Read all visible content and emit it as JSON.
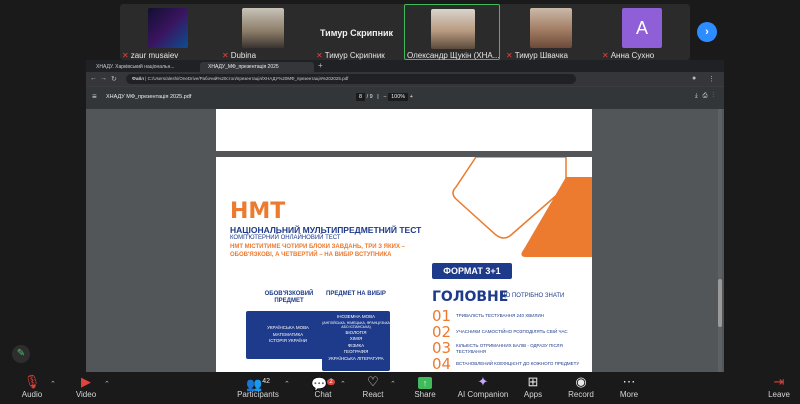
{
  "participants": [
    {
      "name": "zaur musaiev",
      "muted": true
    },
    {
      "name": "Dubina",
      "muted": true
    },
    {
      "name": "Тимур Скрипник",
      "muted": true
    },
    {
      "name": "Олександр Щукін (ХНА...",
      "muted": true
    },
    {
      "name": "Тимур Швачка",
      "muted": true
    },
    {
      "name": "Анна Сухно",
      "muted": true
    }
  ],
  "active_speaker": "Тимур Скрипник",
  "avatar_letter": "A",
  "browser": {
    "tab_active": "ХНАДУ_МФ_презентація 2025",
    "tab_other": "ХНАДУ. Харківський національн...",
    "address": "C:/Users/aleshi/OneDrive/Рабочий%20стол/презентація/ХНАДУ%20МФ_презентація%202025.pdf",
    "address_prefix": "Файл",
    "pdf_title": "ХНАДУ МФ_презентація 2025.pdf",
    "page_current": "8",
    "page_total": "9",
    "zoom": "100%"
  },
  "slide": {
    "title": "НМТ",
    "subtitle": "НАЦІОНАЛЬНИЙ МУЛЬТИПРЕДМЕТНИЙ ТЕСТ",
    "subtitle2": "КОМП'ЮТЕРНИЙ ОНЛАЙНОВИЙ ТЕСТ",
    "description": "НМТ МІСТИТИМЕ ЧОТИРИ БЛОКИ ЗАВДАНЬ, ТРИ З ЯКИХ – ОБОВ'ЯЗКОВІ, А ЧЕТВЕРТИЙ – НА ВИБІР ВСТУПНИКА",
    "format_badge": "ФОРМАТ 3+1",
    "headline": "ГОЛОВНЕ",
    "headline_tail": "ЩО ПОТРІБНО ЗНАТИ",
    "facts": [
      {
        "num": "01",
        "text": "ТРИВАЛІСТЬ ТЕСТУВАННЯ 240 ХВИЛИН"
      },
      {
        "num": "02",
        "text": "УЧАСНИКИ САМОСТІЙНО РОЗПОДІЛЯТЬ СВІЙ ЧАС"
      },
      {
        "num": "03",
        "text": "КІЛЬКІСТЬ ОТРИМАННИХ БАЛІВ - ОДРАЗУ ПІСЛЯ ТЕСТУВАННЯ"
      },
      {
        "num": "04",
        "text": "ВСТАНОВЛЕНИЙ КОЕФІЦІЄНТ ДО КОЖНОГО ПРЕДМЕТУ"
      }
    ],
    "mandatory_head": "ОБОВ'ЯЗКОВИЙ ПРЕДМЕТ",
    "mandatory": [
      "УКРАЇНСЬКА МОВА",
      "МАТЕМАТИКА",
      "ІСТОРІЯ УКРАЇНИ"
    ],
    "elective_head": "ПРЕДМЕТ НА ВИБІР",
    "elective": [
      "ІНОЗЕМНА МОВА",
      "(АНГЛІЙСЬКА, НІМЕЦЬКА, ФРАНЦУЗЬКА АБО ІСПАНСЬКА)",
      "БІОЛОГІЯ",
      "ХІМІЯ",
      "ФІЗИКА",
      "ГЕОГРАФІЯ",
      "УКРАЇНСЬКА ЛІТЕРАТУРА"
    ]
  },
  "toolbar": {
    "audio": "Audio",
    "video": "Video",
    "participants": "Participants",
    "participants_count": "42",
    "chat": "Chat",
    "chat_badge": "2",
    "react": "React",
    "share": "Share",
    "ai": "AI Companion",
    "apps": "Apps",
    "record": "Record",
    "more": "More",
    "leave": "Leave"
  },
  "colors": {
    "accent": "#2d8cff",
    "brand_orange": "#ec7a2f",
    "brand_navy": "#1e3a8a",
    "share_green": "#3fbb5c",
    "mute_red": "#e0433c"
  }
}
